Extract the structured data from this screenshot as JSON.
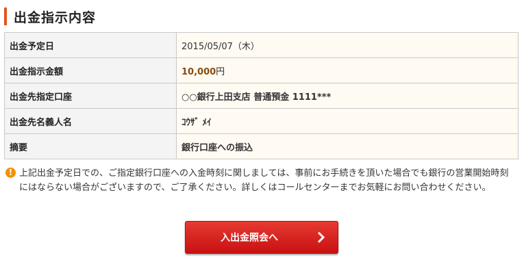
{
  "section": {
    "title": "出金指示内容"
  },
  "rows": [
    {
      "label": "出金予定日",
      "value": "2015/05/07（木）"
    },
    {
      "label": "出金指示金額",
      "amount": "10,000",
      "unit": "円"
    },
    {
      "label": "出金先指定口座",
      "value": "○○銀行上田支店 普通預金 1111***"
    },
    {
      "label": "出金先名義人名",
      "value": "ｺｳｻﾞ ﾒｲ"
    },
    {
      "label": "摘要",
      "value": "銀行口座への振込"
    }
  ],
  "notice": {
    "icon": "exclamation-icon",
    "text": "上記出金予定日での、ご指定銀行口座への入金時刻に関しましては、事前にお手続きを頂いた場合でも銀行の営業開始時刻にはならない場合がございますので、ご了承ください。詳しくはコールセンターまでお気軽にお問い合わせください。"
  },
  "button": {
    "label": "入出金照会へ",
    "icon": "chevron-right-icon"
  },
  "colors": {
    "accent": "#e0551b",
    "value_text": "#8a4b10",
    "button": "#d42020",
    "warning": "#f29200"
  }
}
